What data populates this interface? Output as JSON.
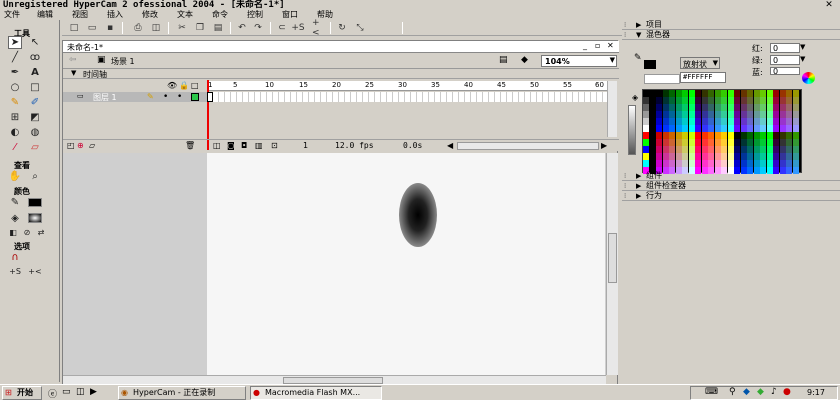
{
  "window": {
    "title": "Unregistered HyperCam 2 ofessional 2004 - [未命名-1*]"
  },
  "menu": [
    "文件",
    "编辑",
    "视图",
    "插入",
    "修改",
    "文本",
    "命令",
    "控制",
    "窗口",
    "帮助"
  ],
  "tools": {
    "header": "工具",
    "view_header": "查看",
    "colors_header": "颜色",
    "options_header": "选项"
  },
  "document": {
    "tab": "未命名-1*",
    "scene": "场景 1",
    "zoom": "104%"
  },
  "timeline": {
    "label": "时间轴",
    "layer": "图层 1",
    "frames": [
      "1",
      "5",
      "10",
      "15",
      "20",
      "25",
      "30",
      "35",
      "40",
      "45",
      "50",
      "55",
      "60"
    ],
    "current_frame": "1",
    "fps": "12.0 fps",
    "time": "0.0s"
  },
  "panels": {
    "project": "项目",
    "mixer": "混色器",
    "components": "组件",
    "component_inspector": "组件检查器",
    "behaviors": "行为"
  },
  "mixer": {
    "red_label": "红:",
    "green_label": "绿:",
    "blue_label": "蓝:",
    "red": "0",
    "green": "0",
    "blue": "0",
    "fill_type": "放射状",
    "hex": "#FFFFFF"
  },
  "taskbar": {
    "start": "开始",
    "task1": "HyperCam - 正在录制",
    "task2": "Macromedia Flash MX...",
    "clock": "9:17"
  }
}
